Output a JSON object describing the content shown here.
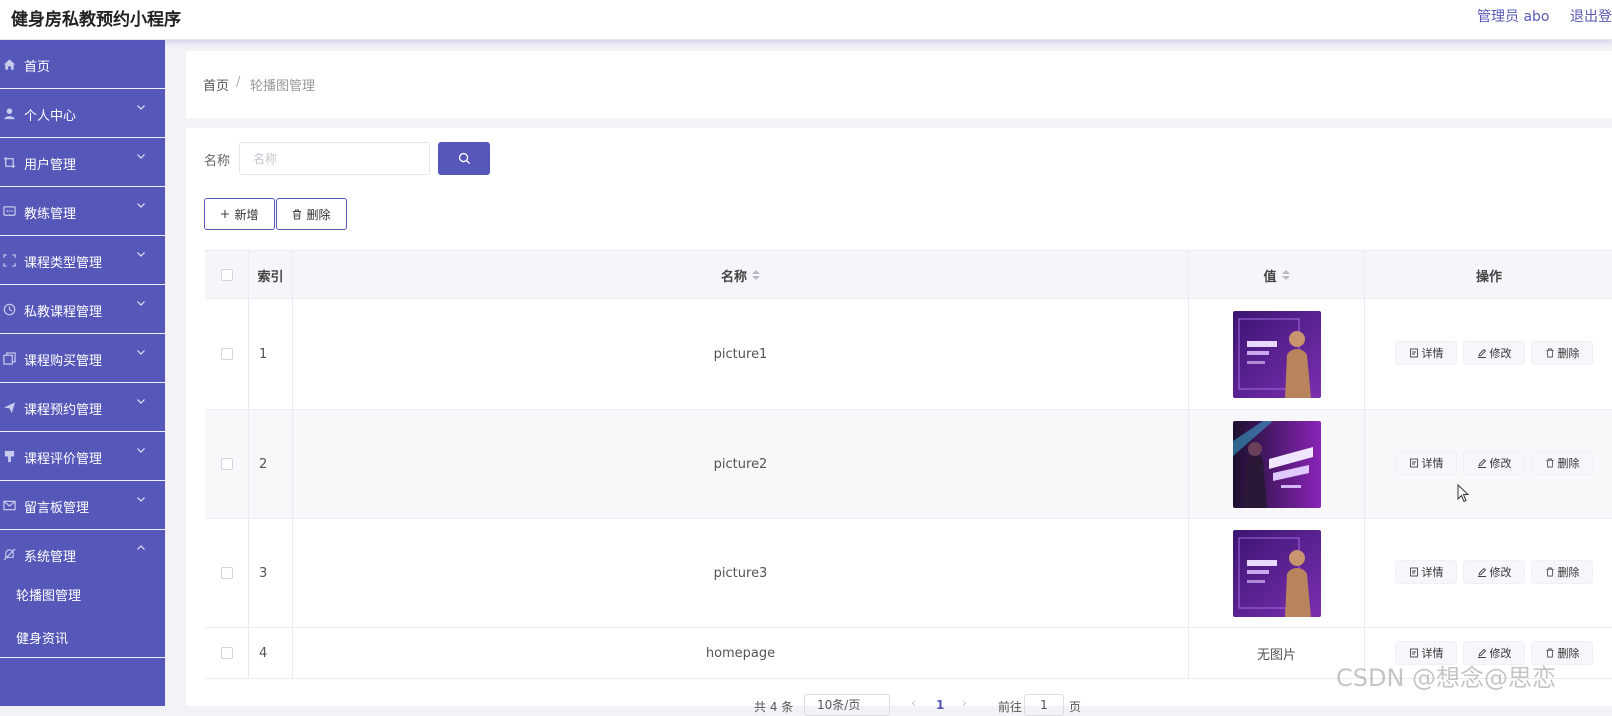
{
  "header": {
    "app_title": "健身房私教预约小程序",
    "admin": "管理员 abo",
    "logout": "退出登"
  },
  "sidebar": {
    "items": [
      {
        "label": "首页",
        "icon": "home-icon",
        "has_chevron": false
      },
      {
        "label": "个人中心",
        "icon": "user-icon",
        "has_chevron": true
      },
      {
        "label": "用户管理",
        "icon": "crop-icon",
        "has_chevron": true
      },
      {
        "label": "教练管理",
        "icon": "message-icon",
        "has_chevron": true
      },
      {
        "label": "课程类型管理",
        "icon": "fullscreen-icon",
        "has_chevron": true
      },
      {
        "label": "私教课程管理",
        "icon": "clock-icon",
        "has_chevron": true
      },
      {
        "label": "课程购买管理",
        "icon": "copy-icon",
        "has_chevron": true
      },
      {
        "label": "课程预约管理",
        "icon": "send-icon",
        "has_chevron": true
      },
      {
        "label": "课程评价管理",
        "icon": "brush-icon",
        "has_chevron": true
      },
      {
        "label": "留言板管理",
        "icon": "mail-icon",
        "has_chevron": true
      },
      {
        "label": "系统管理",
        "icon": "bell-off-icon",
        "has_chevron": true,
        "expanded": true
      }
    ],
    "sub_items": [
      {
        "label": "轮播图管理",
        "active": true
      },
      {
        "label": "健身资讯",
        "active": false
      }
    ]
  },
  "breadcrumb": {
    "home": "首页",
    "separator": "/",
    "current": "轮播图管理"
  },
  "search": {
    "label": "名称",
    "placeholder": "名称",
    "value": ""
  },
  "toolbar": {
    "add_label": "新增",
    "delete_label": "删除"
  },
  "table": {
    "columns": {
      "index": "索引",
      "name": "名称",
      "value": "值",
      "actions": "操作"
    },
    "rows": [
      {
        "index": "1",
        "name": "picture1",
        "image": "poster-a",
        "image_text": ""
      },
      {
        "index": "2",
        "name": "picture2",
        "image": "poster-b",
        "image_text": ""
      },
      {
        "index": "3",
        "name": "picture3",
        "image": "poster-a",
        "image_text": ""
      },
      {
        "index": "4",
        "name": "homepage",
        "image": null,
        "image_text": "无图片"
      }
    ],
    "actions": {
      "detail": "详情",
      "edit": "修改",
      "delete": "删除"
    }
  },
  "pagination": {
    "total": "共 4 条",
    "page_size": "10条/页",
    "current_page": "1",
    "goto_prefix": "前往",
    "goto_value": "1",
    "goto_suffix": "页"
  },
  "watermark": "CSDN @想念@思恋",
  "colors": {
    "sidebar": "#5557b9",
    "accent": "#5557b9",
    "header_text": "#5a5ab5",
    "poster_purple": "#5a1d8c"
  }
}
